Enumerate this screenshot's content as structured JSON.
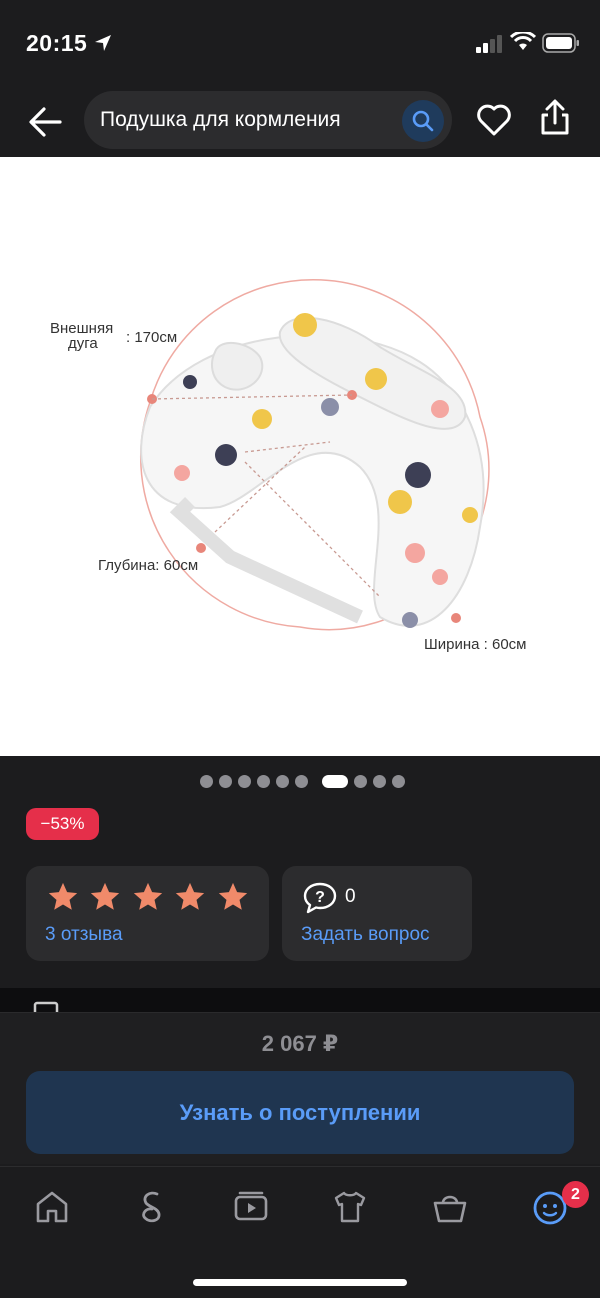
{
  "status_bar": {
    "time": "20:15"
  },
  "header": {
    "search_text": "Подушка для кормления",
    "icons": [
      "back-arrow-icon",
      "search-icon",
      "heart-icon",
      "share-icon"
    ]
  },
  "product_image": {
    "labels": {
      "outer_arc_line1": "Внешняя",
      "outer_arc_line2": "дуга",
      "outer_arc_value": ": 170см",
      "depth": "Глубина: 60см",
      "width": "Ширина : 60см"
    }
  },
  "gallery": {
    "image_count": 10,
    "active_index": 6
  },
  "discount": "−53%",
  "rating": {
    "stars": 5,
    "reviews_label": "3 отзыва"
  },
  "questions": {
    "count": "0",
    "ask_label": "Задать вопрос"
  },
  "purchase": {
    "price": "2 067 ₽",
    "notify_label": "Узнать о поступлении"
  },
  "tabbar": {
    "items": [
      "home-icon",
      "brand-logo-icon",
      "video-icon",
      "catalog-icon",
      "basket-icon",
      "profile-icon"
    ],
    "profile_badge": "2"
  },
  "colors": {
    "accent": "#5a9cf8",
    "badge": "#e52f4a",
    "star": "#f08a6a",
    "background": "#1c1c1e"
  }
}
